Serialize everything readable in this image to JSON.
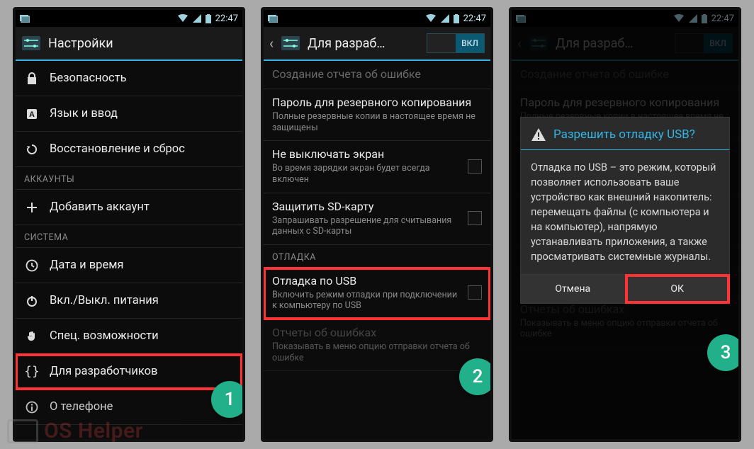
{
  "status": {
    "time": "22:47"
  },
  "screen1": {
    "title": "Настройки",
    "items": [
      {
        "icon": "lock",
        "label": "Безопасность"
      },
      {
        "icon": "lang",
        "label": "Язык и ввод"
      },
      {
        "icon": "restore",
        "label": "Восстановление и сброс"
      }
    ],
    "sectionAccounts": "Аккаунты",
    "addAccount": {
      "icon": "plus",
      "label": "Добавить аккаунт"
    },
    "sectionSystem": "Система",
    "systemItems": [
      {
        "icon": "clock",
        "label": "Дата и время"
      },
      {
        "icon": "power",
        "label": "Вкл./Выкл. питания"
      },
      {
        "icon": "hand",
        "label": "Спец. возможности"
      },
      {
        "icon": "braces",
        "label": "Для разработчиков"
      },
      {
        "icon": "info",
        "label": "О телефоне"
      }
    ],
    "badge": "1"
  },
  "screen2": {
    "title": "Для разраб…",
    "toggleOn": "ВКЛ",
    "rows": {
      "bugreport": {
        "title": "Создание отчета об ошибке",
        "sub": ""
      },
      "backupPw": {
        "title": "Пароль для резервного копирования",
        "sub": "Полные резервные копии в настоящее время не защищены"
      },
      "stayAwake": {
        "title": "Не выключать экран",
        "sub": "Во время зарядки экран будет всегда включен"
      },
      "protectSd": {
        "title": "Защитить SD-карту",
        "sub": "Запрашивать разрешение для считывания данных с SD-карты"
      },
      "section": "Отладка",
      "usbDebug": {
        "title": "Отладка по USB",
        "sub": "Включить режим отладки при подключении к компьютеру по USB"
      },
      "errReport": {
        "title": "Отчеты об ошибках",
        "sub": "Показывать в меню опцию отправки отчета об ошибке"
      }
    },
    "badge": "2"
  },
  "screen3": {
    "title": "Для разраб…",
    "toggleOn": "ВКЛ",
    "dialog": {
      "title": "Разрешить отладку USB?",
      "body": "Отладка по USB – это режим, который позволяет использовать ваше устройство как внешний накопитель: перемещать файлы (с компьютера и на компьютер), напрямую устанавливать приложения, а также просматривать системные журналы.",
      "cancel": "Отмена",
      "ok": "ОК"
    },
    "badge": "3"
  },
  "watermark": "OS Helper"
}
